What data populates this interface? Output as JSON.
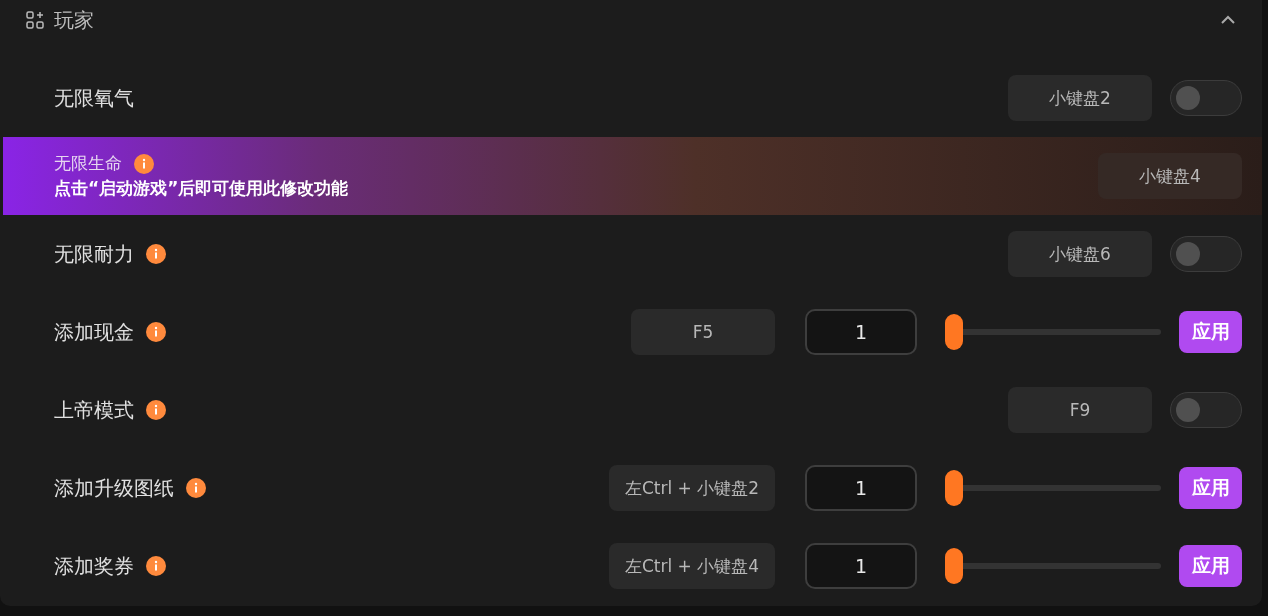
{
  "section": {
    "title": "玩家",
    "expanded": true
  },
  "rows": [
    {
      "kind": "toggle",
      "label": "无限氧气",
      "info": false,
      "hotkey": "小键盘2",
      "on": false
    },
    {
      "kind": "notice",
      "label": "无限生命",
      "info": true,
      "notice": "点击“启动游戏”后即可使用此修改功能",
      "hotkey": "小键盘4"
    },
    {
      "kind": "toggle",
      "label": "无限耐力",
      "info": true,
      "hotkey": "小键盘6",
      "on": false
    },
    {
      "kind": "slider",
      "label": "添加现金",
      "info": true,
      "hotkey": "F5",
      "value": "1",
      "level": 0,
      "action": "应用"
    },
    {
      "kind": "toggle",
      "label": "上帝模式",
      "info": true,
      "hotkey": "F9",
      "on": false
    },
    {
      "kind": "slider",
      "label": "添加升级图纸",
      "info": true,
      "hotkey": "左Ctrl + 小键盘2",
      "value": "1",
      "level": 0,
      "action": "应用"
    },
    {
      "kind": "slider",
      "label": "添加奖券",
      "info": true,
      "hotkey": "左Ctrl + 小键盘4",
      "value": "1",
      "level": 0,
      "action": "应用"
    }
  ]
}
